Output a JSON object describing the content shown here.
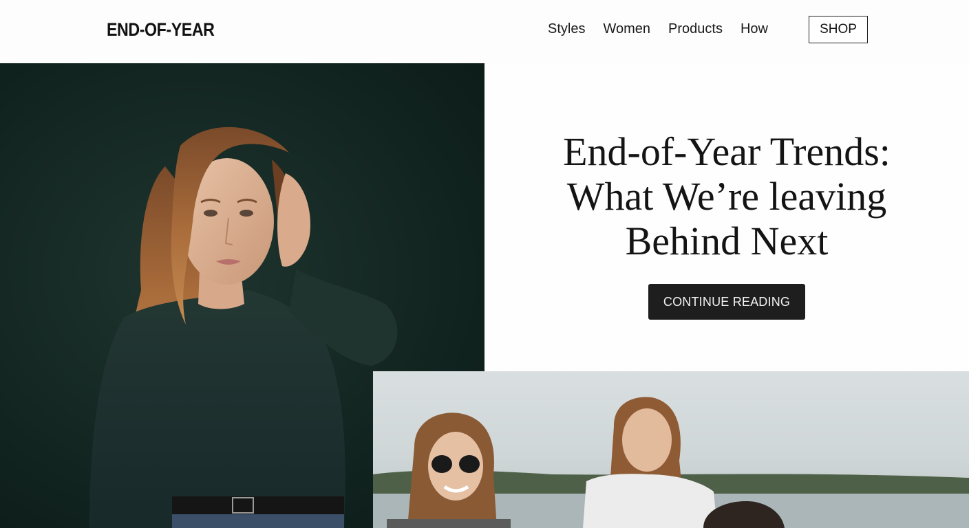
{
  "header": {
    "logo": "END-OF-YEAR",
    "nav": [
      "Styles",
      "Women",
      "Products",
      "How"
    ],
    "shop_label": "SHOP"
  },
  "hero": {
    "headline_lines": [
      "End-of-Year Trends:",
      "What We’re leaving",
      "Behind Next"
    ],
    "cta_label": "CONTINUE READING"
  },
  "colors": {
    "hero_bg": "#132622",
    "button_bg": "#1e1e1e",
    "text": "#141414"
  }
}
